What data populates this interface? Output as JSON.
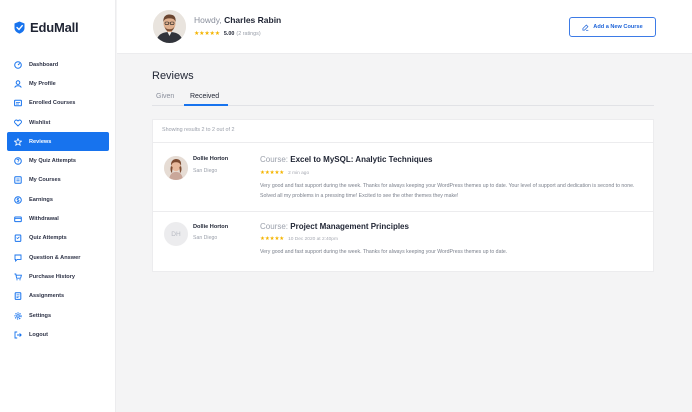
{
  "brand": {
    "name": "EduMall",
    "accent": "#1773ee"
  },
  "sidebar": {
    "items": [
      {
        "label": "Dashboard",
        "icon": "dashboard-icon",
        "active": false
      },
      {
        "label": "My Profile",
        "icon": "user-icon",
        "active": false
      },
      {
        "label": "Enrolled Courses",
        "icon": "courses-icon",
        "active": false
      },
      {
        "label": "Wishlist",
        "icon": "heart-icon",
        "active": false
      },
      {
        "label": "Reviews",
        "icon": "star-icon",
        "active": true
      },
      {
        "label": "My Quiz Attempts",
        "icon": "quiz-icon",
        "active": false
      },
      {
        "label": "My Courses",
        "icon": "book-icon",
        "active": false
      },
      {
        "label": "Earnings",
        "icon": "dollar-icon",
        "active": false
      },
      {
        "label": "Withdrawal",
        "icon": "withdraw-icon",
        "active": false
      },
      {
        "label": "Quiz Attempts",
        "icon": "clipboard-icon",
        "active": false
      },
      {
        "label": "Question & Answer",
        "icon": "chat-icon",
        "active": false
      },
      {
        "label": "Purchase History",
        "icon": "cart-icon",
        "active": false
      },
      {
        "label": "Assignments",
        "icon": "assignment-icon",
        "active": false
      },
      {
        "label": "Settings",
        "icon": "gear-icon",
        "active": false
      },
      {
        "label": "Logout",
        "icon": "logout-icon",
        "active": false
      }
    ]
  },
  "header": {
    "greeting": "Howdy,",
    "user_name": "Charles Rabin",
    "rating_score": "5.00",
    "rating_count": "(2 ratings)",
    "add_course_label": "Add a New Course"
  },
  "main": {
    "title": "Reviews",
    "tabs": [
      {
        "label": "Given",
        "active": false
      },
      {
        "label": "Received",
        "active": true
      }
    ],
    "showing_text": "Showing results 2 to 2 out of 2",
    "reviews": [
      {
        "name": "Dollie Horton",
        "location": "San Diego",
        "initials": "",
        "course_prefix": "Course:",
        "course_title": "Excel to MySQL: Analytic Techniques",
        "rating": 5,
        "date": "2 min ago",
        "text": "Very good and fast support during the week. Thanks for always keeping your WordPress themes up to date. Your level of support and dedication is second to none. Solved all my problems in a pressing time! Excited to see the other themes they make!"
      },
      {
        "name": "Dollie Horton",
        "location": "San Diego",
        "initials": "DH",
        "course_prefix": "Course:",
        "course_title": "Project Management Principles",
        "rating": 5,
        "date": "10 Dec 2020 at 2:40pm",
        "text": "Very good and fast support during the week. Thanks for always keeping your WordPress themes up to date."
      }
    ]
  }
}
